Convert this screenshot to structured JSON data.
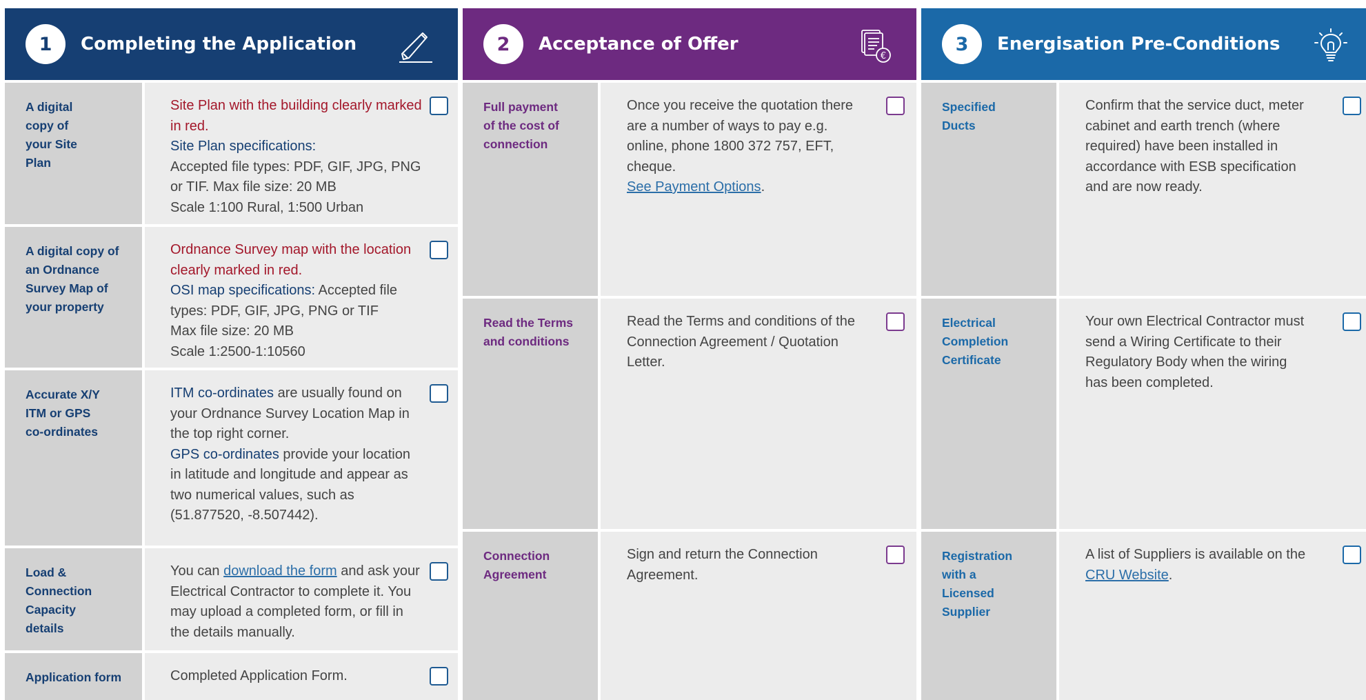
{
  "sections": [
    {
      "number": "1",
      "title": "Completing the Application",
      "icon": "pencil-icon",
      "color": "#163f73",
      "rows": [
        {
          "label": "A digital copy of your Site Plan",
          "lines": [
            {
              "parts": [
                {
                  "t": "Site Plan with the building clearly marked in red.",
                  "s": "red"
                }
              ]
            },
            {
              "parts": [
                {
                  "t": "Site Plan specifications:",
                  "s": "blue"
                }
              ]
            },
            {
              "parts": [
                {
                  "t": "Accepted file types: PDF, GIF, JPG, PNG or TIF. Max file size: 20 MB",
                  "s": ""
                }
              ]
            },
            {
              "parts": [
                {
                  "t": "Scale 1:100 Rural, 1:500 Urban",
                  "s": ""
                }
              ]
            }
          ]
        },
        {
          "label": "A digital copy of an Ordnance Survey Map of your property",
          "lines": [
            {
              "parts": [
                {
                  "t": "Ordnance Survey map with the location clearly marked in red.",
                  "s": "red"
                }
              ]
            },
            {
              "parts": [
                {
                  "t": "OSI map specifications:",
                  "s": "blue"
                },
                {
                  "t": " Accepted file types: PDF, GIF, JPG, PNG or TIF",
                  "s": ""
                }
              ]
            },
            {
              "parts": [
                {
                  "t": "Max file size: 20 MB",
                  "s": ""
                }
              ]
            },
            {
              "parts": [
                {
                  "t": "Scale 1:2500-1:10560",
                  "s": ""
                }
              ]
            }
          ]
        },
        {
          "label": "Accurate X/Y ITM or GPS co-ordinates",
          "lines": [
            {
              "parts": [
                {
                  "t": "ITM co-ordinates",
                  "s": "blue"
                },
                {
                  "t": " are usually found on your Ordnance Survey Location Map in the top right corner.",
                  "s": ""
                }
              ]
            },
            {
              "parts": [
                {
                  "t": "GPS co-ordinates",
                  "s": "blue"
                },
                {
                  "t": " provide your location in latitude and longitude and appear as two numerical values, such as (51.877520, -8.507442).",
                  "s": ""
                }
              ]
            }
          ]
        },
        {
          "label": "Load & Connection Capacity details",
          "lines": [
            {
              "parts": [
                {
                  "t": "You can ",
                  "s": ""
                },
                {
                  "t": "download the form",
                  "s": "lnk"
                },
                {
                  "t": " and ask your Electrical Contractor to complete it. You may upload a completed form, or fill in the details manually.",
                  "s": ""
                }
              ]
            }
          ]
        },
        {
          "label": "Application form",
          "lines": [
            {
              "parts": [
                {
                  "t": "Completed Application Form.",
                  "s": ""
                }
              ]
            }
          ]
        }
      ]
    },
    {
      "number": "2",
      "title": "Acceptance of Offer",
      "icon": "document-euro-icon",
      "color": "#6d2a80",
      "rows": [
        {
          "label": "Full payment of the cost of connection",
          "lines": [
            {
              "parts": [
                {
                  "t": "Once you receive the quotation there are a number of ways to pay e.g. online, phone 1800 372 757, EFT, cheque.",
                  "s": ""
                }
              ]
            },
            {
              "parts": [
                {
                  "t": " ",
                  "s": ""
                }
              ]
            },
            {
              "parts": [
                {
                  "t": "See Payment Options",
                  "s": "lnk"
                },
                {
                  "t": ".",
                  "s": ""
                }
              ]
            }
          ]
        },
        {
          "label": "Read the Terms and conditions",
          "lines": [
            {
              "parts": [
                {
                  "t": "Read the Terms and conditions of the Connection Agreement / Quotation Letter.",
                  "s": ""
                }
              ]
            }
          ]
        },
        {
          "label": "Connection Agreement",
          "lines": [
            {
              "parts": [
                {
                  "t": "Sign and return the Connection Agreement.",
                  "s": ""
                }
              ]
            }
          ]
        }
      ]
    },
    {
      "number": "3",
      "title": "Energisation Pre-Conditions",
      "icon": "lightbulb-icon",
      "color": "#1b69a8",
      "rows": [
        {
          "label": "Specified Ducts",
          "lines": [
            {
              "parts": [
                {
                  "t": "Confirm that the service duct, meter cabinet and earth trench (where required) have been installed in accordance with ESB specification and are now ready.",
                  "s": ""
                }
              ]
            }
          ]
        },
        {
          "label": "Electrical Completion Certificate",
          "lines": [
            {
              "parts": [
                {
                  "t": "Your own Electrical Contractor must send a Wiring Certificate to their Regulatory Body when the wiring has been completed.",
                  "s": ""
                }
              ]
            }
          ]
        },
        {
          "label": "Registration with a Licensed Supplier",
          "lines": [
            {
              "parts": [
                {
                  "t": "A list of Suppliers is available on the ",
                  "s": ""
                },
                {
                  "t": "CRU Website",
                  "s": "lnk"
                },
                {
                  "t": ".",
                  "s": ""
                }
              ]
            }
          ]
        }
      ]
    }
  ]
}
